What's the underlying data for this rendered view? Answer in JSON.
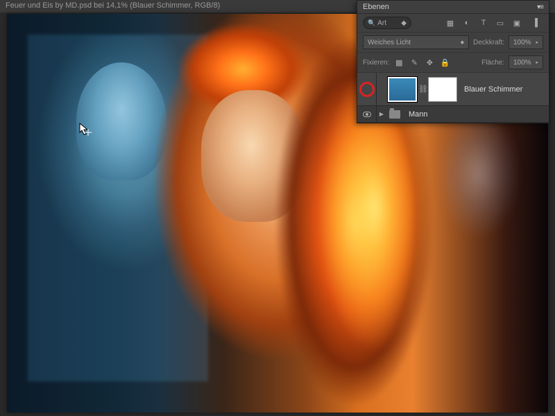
{
  "titlebar": "Feuer und Eis by MD.psd bei 14,1% (Blauer Schimmer, RGB/8)",
  "panel": {
    "tab": "Ebenen",
    "search_label": "Art",
    "blend_mode": "Weiches Licht",
    "opacity_label": "Deckkraft:",
    "opacity_value": "100%",
    "lock_label": "Fixieren:",
    "fill_label": "Fläche:",
    "fill_value": "100%",
    "layers": [
      {
        "name": "Blauer Schimmer"
      },
      {
        "name": "Mann"
      }
    ]
  }
}
